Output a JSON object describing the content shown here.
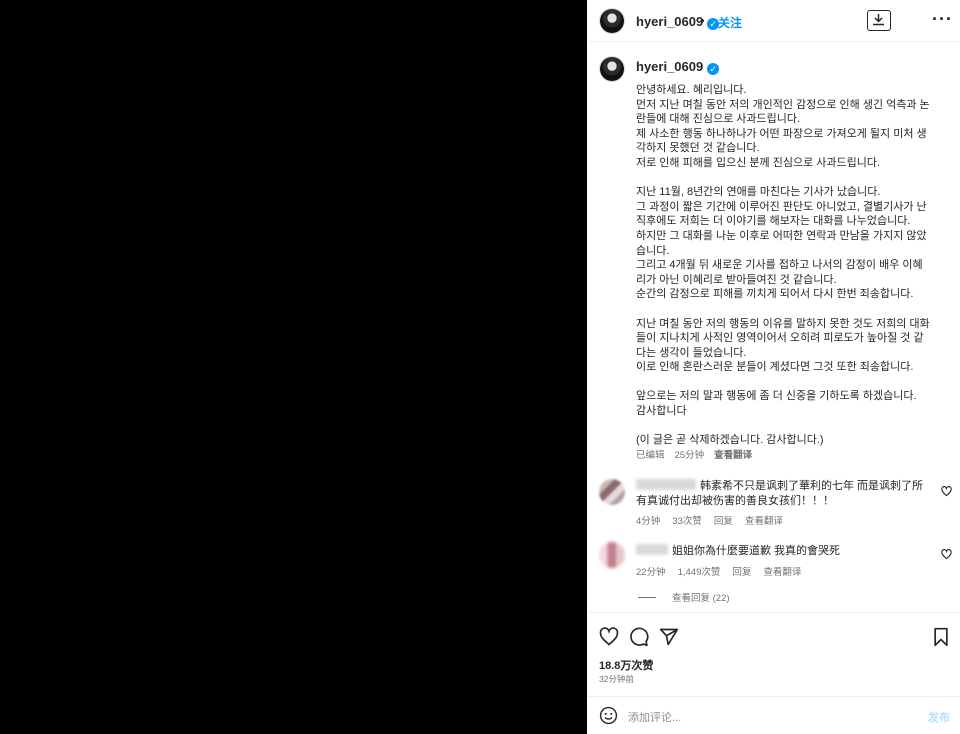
{
  "header": {
    "username": "hyeri_0609",
    "separator": "•",
    "follow_label": "关注",
    "more_label": "···"
  },
  "caption": {
    "username": "hyeri_0609",
    "lines": [
      "안녕하세요. 혜리입니다.",
      "먼저 지난 며칠 동안 저의 개인적인 감정으로 인해 생긴 억측과 논",
      "란들에 대해 진심으로 사과드립니다.",
      "제 사소한 행동 하나하나가 어떤 파장으로 가져오게 될지 미처 생",
      "각하지 못했던 것 같습니다.",
      "저로 인해 피해를 입으신 분께 진심으로 사과드립니다.",
      "",
      "지난 11월, 8년간의 연애를 마친다는 기사가 났습니다.",
      "그 과정이 짧은 기간에 이루어진 판단도 아니었고, 결별기사가 난",
      "직후에도 저희는 더 이야기를 해보자는 대화를 나누었습니다.",
      "하지만 그 대화를 나눈 이후로 어떠한 연락과 만남을 가지지 않았",
      "습니다.",
      "그리고 4개월 뒤 새로운 기사를 접하고 나서의 감정이 배우 이혜",
      "리가 아닌 이혜리로 받아들여진 것 같습니다.",
      "순간의 감정으로 피해를 끼치게 되어서 다시 한번 죄송합니다.",
      "",
      "지난 며칠 동안 저의 행동의 이유를 말하지 못한 것도 저희의 대화",
      "들이 지나치게 사적인 영역이어서 오히려 피로도가 높아질 것 같",
      "다는 생각이 들었습니다.",
      "이로 인해 혼란스러운 분들이 계셨다면 그것 또한 죄송합니다.",
      "",
      "앞으로는 저의 말과 행동에 좀 더 신중을 기하도록 하겠습니다.",
      "감사합니다",
      "",
      "(이 글은 곧 삭제하겠습니다. 감사합니다.)"
    ],
    "edited_label": "已编辑",
    "age": "25分钟",
    "translate_label": "查看翻译"
  },
  "comments": [
    {
      "text": "韩素希不只是讽刺了華利的七年 而是讽刺了所有真诚付出却被伤害的善良女孩们！！！",
      "age": "4分钟",
      "likes": "33次赞",
      "reply_label": "回复",
      "translate_label": "查看翻译"
    },
    {
      "text": "姐姐你為什麼要道歉 我真的會哭死",
      "age": "22分钟",
      "likes": "1,449次赞",
      "reply_label": "回复",
      "translate_label": "查看翻译"
    }
  ],
  "view_replies_label": "查看回复 (22)",
  "post": {
    "likes": "18.8万次赞",
    "time": "32分钟前"
  },
  "add_comment": {
    "placeholder": "添加评论...",
    "post_label": "发布"
  }
}
